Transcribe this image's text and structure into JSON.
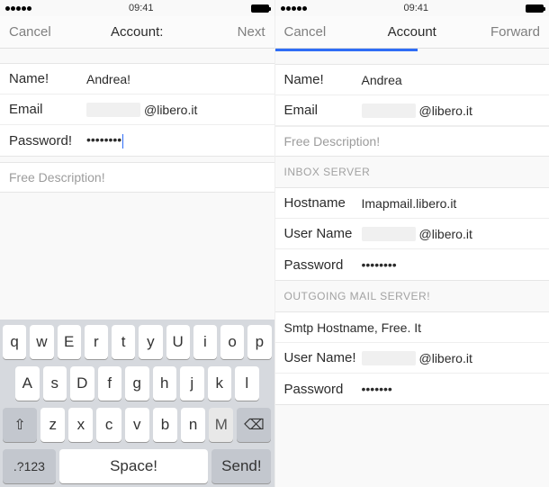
{
  "status": {
    "time": "09:41"
  },
  "left": {
    "nav": {
      "cancel": "Cancel",
      "title": "Account:",
      "next": "Next"
    },
    "fields": {
      "name_label": "Name!",
      "name_value": "Andrea!",
      "email_label": "Email",
      "email_suffix": "@libero.it",
      "password_label": "Password!",
      "password_value": "••••••••",
      "description_placeholder": "Free Description!"
    },
    "keyboard": {
      "r1": [
        "q",
        "w",
        "E",
        "r",
        "t",
        "y",
        "U",
        "i",
        "o",
        "p"
      ],
      "r2": [
        "A",
        "s",
        "D",
        "f",
        "g",
        "h",
        "j",
        "k",
        "l"
      ],
      "r3": [
        "z",
        "x",
        "c",
        "v",
        "b",
        "n",
        "M"
      ],
      "shift": "⇧",
      "del": "⌫",
      "numkey": ".?123",
      "space": "Space!",
      "send": "Send!"
    }
  },
  "right": {
    "nav": {
      "cancel": "Cancel",
      "title": "Account",
      "forward": "Forward"
    },
    "fields": {
      "name_label": "Name!",
      "name_value": "Andrea",
      "email_label": "Email",
      "email_suffix": "@libero.it",
      "description_placeholder": "Free Description!"
    },
    "inbox": {
      "header": "INBOX SERVER",
      "host_label": "Hostname",
      "host_value": "Imapmail.libero.it",
      "user_label": "User Name",
      "user_suffix": "@libero.it",
      "pass_label": "Password",
      "pass_value": "••••••••"
    },
    "outgoing": {
      "header": "OUTGOING MAIL SERVER!",
      "host_label": "Smtp Hostname, Free. It",
      "user_label": "User Name!",
      "user_suffix": "@libero.it",
      "pass_label": "Password",
      "pass_value": "•••••••"
    }
  }
}
